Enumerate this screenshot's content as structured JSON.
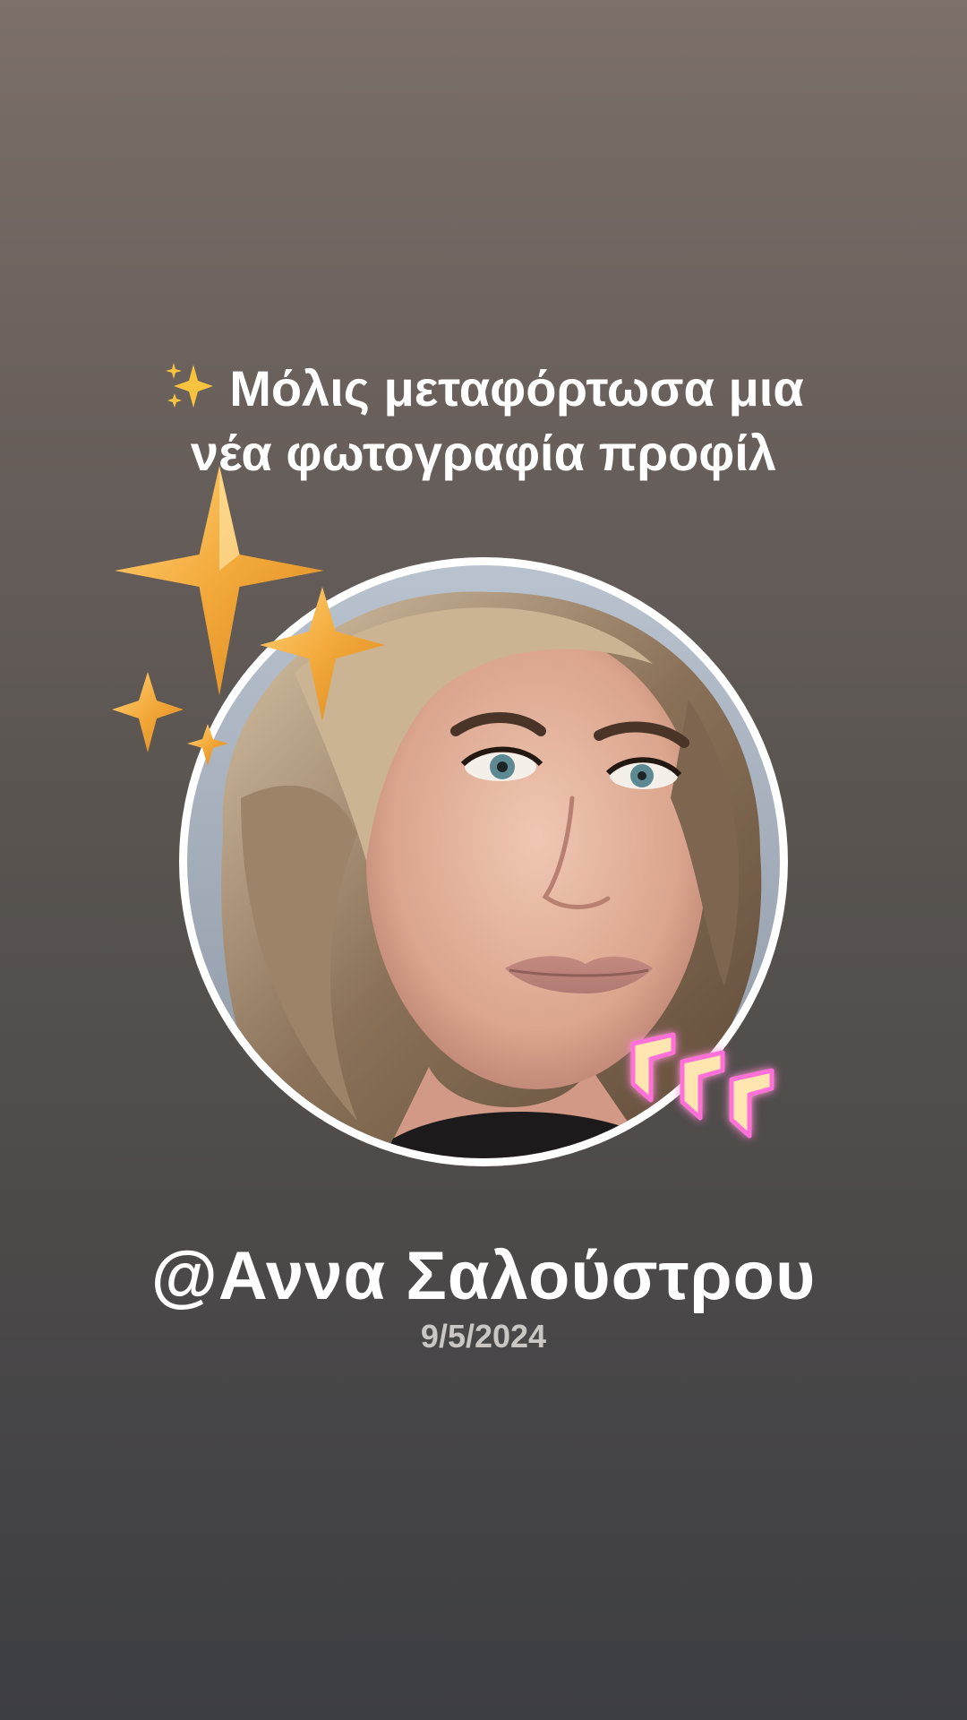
{
  "post": {
    "headline_line1": "Μόλις μεταφόρτωσα μια",
    "headline_line2": "νέα φωτογραφία προφίλ",
    "username": "@Αννα Σαλούστρου",
    "date": "9/5/2024"
  },
  "decorations": {
    "headline_emoji": "sparkles-icon",
    "avatar_overlay_top_left": "gold-sparkle-stars-icon",
    "avatar_overlay_bottom_right": "neon-pink-chevrons-icon"
  },
  "colors": {
    "background_top": "#7c7068",
    "background_bottom": "#3d3e44",
    "text": "#ffffff",
    "date_text": "#c9c6c4",
    "avatar_ring": "#ffffff",
    "star_gold": "#f3a93a",
    "neon_pink": "#ff6fd8"
  }
}
